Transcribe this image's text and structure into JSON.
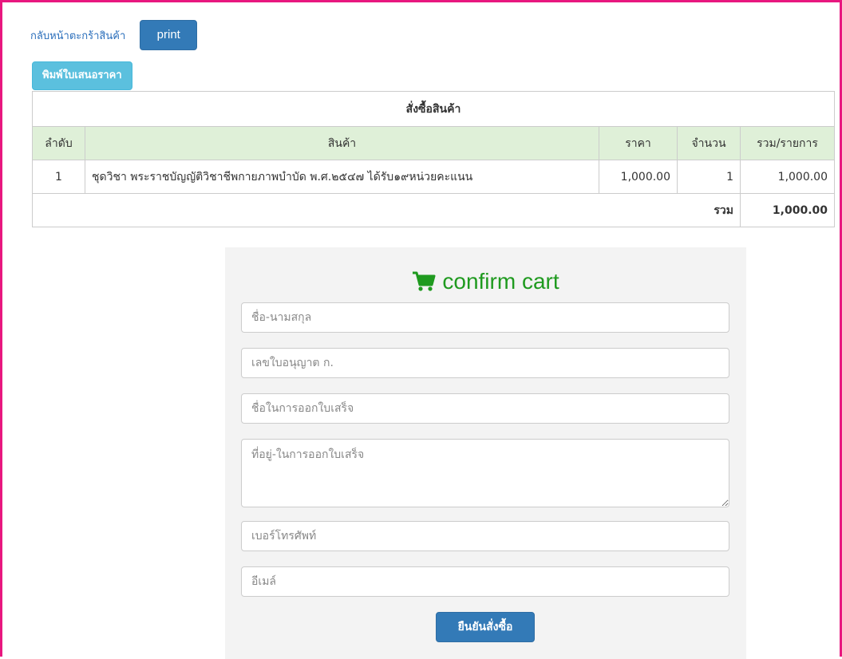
{
  "top": {
    "back_link": "กลับหน้าตะกร้าสินค้า",
    "print_label": "print",
    "quote_label": "พิมพ์ใบเสนอราคา"
  },
  "order_table": {
    "caption": "สั่งซื้อสินค้า",
    "columns": [
      "ลำดับ",
      "สินค้า",
      "ราคา",
      "จำนวน",
      "รวม/รายการ"
    ],
    "rows": [
      {
        "index": "1",
        "product": "ชุดวิชา พระราชบัญญัติวิชาชีพกายภาพบำบัด พ.ศ.๒๕๔๗ ได้รับ๑๙หน่วยคะแนน",
        "price": "1,000.00",
        "qty": "1",
        "line_total": "1,000.00"
      }
    ],
    "total_label": "รวม",
    "total_value": "1,000.00"
  },
  "confirm_form": {
    "title": "confirm cart",
    "icon": "shopping-cart-icon",
    "fields": {
      "name_placeholder": "ชื่อ-นามสกุล",
      "license_placeholder": "เลขใบอนุญาต ก.",
      "invoice_name_placeholder": "ชื่อในการออกใบเสร็จ",
      "address_placeholder": "ที่อยู่-ในการออกใบเสร็จ",
      "phone_placeholder": "เบอร์โทรศัพท์",
      "email_placeholder": "อีเมล์"
    },
    "submit_label": "ยืนยันสั่งซื้อ"
  },
  "colors": {
    "frame_border": "#e8177f",
    "primary_button": "#337ab7",
    "info_button": "#5bc0de",
    "table_header": "#dff0d8",
    "confirm_title": "#1f9a1f",
    "panel_bg": "#f3f3f3"
  }
}
